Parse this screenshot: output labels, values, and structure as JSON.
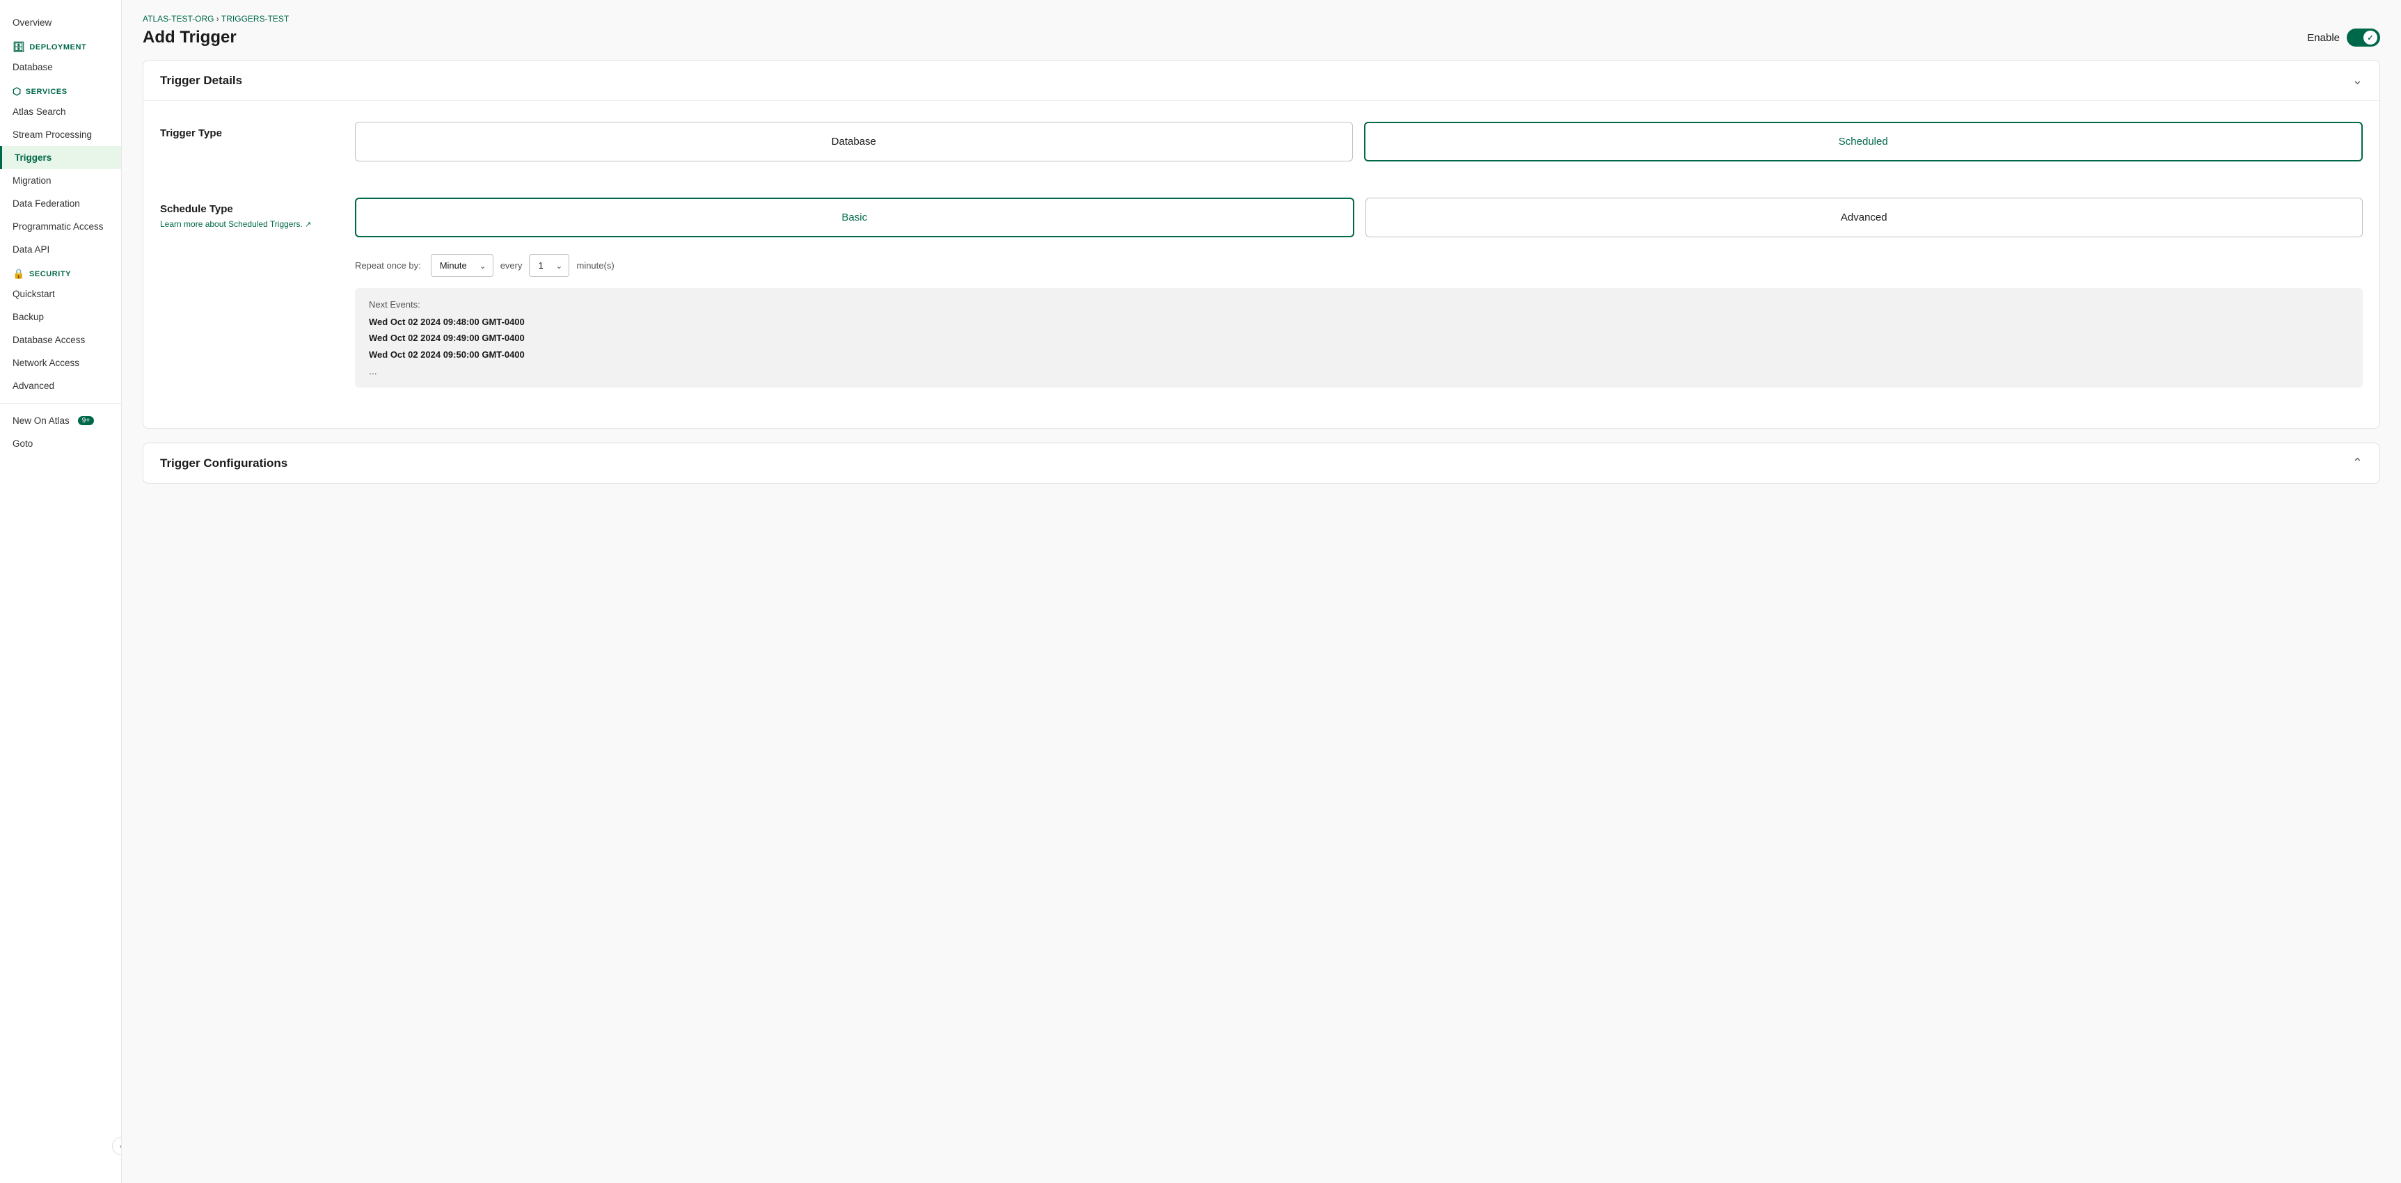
{
  "sidebar": {
    "overview_label": "Overview",
    "deployment_label": "DEPLOYMENT",
    "database_label": "Database",
    "services_label": "SERVICES",
    "atlas_search_label": "Atlas Search",
    "stream_processing_label": "Stream Processing",
    "triggers_label": "Triggers",
    "migration_label": "Migration",
    "data_federation_label": "Data Federation",
    "programmatic_access_label": "Programmatic Access",
    "data_api_label": "Data API",
    "security_label": "SECURITY",
    "quickstart_label": "Quickstart",
    "backup_label": "Backup",
    "database_access_label": "Database Access",
    "network_access_label": "Network Access",
    "advanced_label": "Advanced",
    "new_on_atlas_label": "New On Atlas",
    "new_on_atlas_badge": "9+",
    "goto_label": "Goto"
  },
  "header": {
    "breadcrumb_org": "ATLAS-TEST-ORG",
    "breadcrumb_separator": " › ",
    "breadcrumb_app": "TRIGGERS-TEST",
    "page_title": "Add Trigger",
    "enable_label": "Enable"
  },
  "trigger_details_card": {
    "title": "Trigger Details",
    "chevron": "›",
    "trigger_type_label": "Trigger Type",
    "database_btn": "Database",
    "scheduled_btn": "Scheduled",
    "schedule_type_label": "Schedule Type",
    "learn_more_text": "Learn more about Scheduled Triggers.",
    "basic_btn": "Basic",
    "advanced_btn": "Advanced",
    "repeat_label": "Repeat once by:",
    "minute_option": "Minute",
    "every_label": "every",
    "every_value": "1",
    "unit_label": "minute(s)",
    "next_events_title": "Next Events:",
    "event1": "Wed Oct 02 2024 09:48:00 GMT-0400",
    "event2": "Wed Oct 02 2024 09:49:00 GMT-0400",
    "event3": "Wed Oct 02 2024 09:50:00 GMT-0400",
    "ellipsis": "..."
  },
  "trigger_configurations_card": {
    "title": "Trigger Configurations",
    "chevron_up": "˄"
  }
}
